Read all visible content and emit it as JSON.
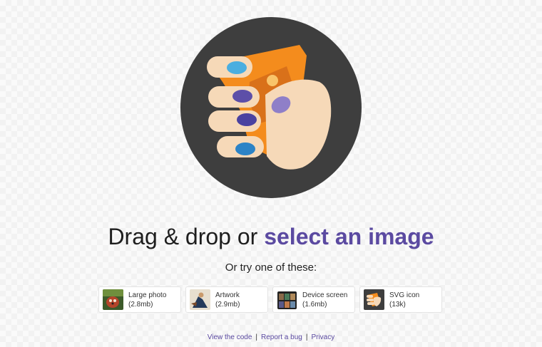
{
  "headline": {
    "prefix": "Drag & drop or",
    "link": "select an image"
  },
  "subline": "Or try one of these:",
  "demos": [
    {
      "title": "Large photo",
      "size": "(2.8mb)",
      "thumb_icon": "red-panda-photo-icon"
    },
    {
      "title": "Artwork",
      "size": "(2.9mb)",
      "thumb_icon": "artwork-icon"
    },
    {
      "title": "Device screen",
      "size": "(1.6mb)",
      "thumb_icon": "device-screen-icon"
    },
    {
      "title": "SVG icon",
      "size": "(13k)",
      "thumb_icon": "squoosh-logo-icon"
    }
  ],
  "footer": {
    "links": [
      "View the code",
      "Report a bug",
      "Privacy"
    ],
    "separator": "|"
  },
  "colors": {
    "accent": "#5b4aa1",
    "logo_circle": "#3e3e3e",
    "logo_orange": "#f48c1d",
    "nail_blue": "#2c83c6",
    "nail_purple": "#5d4fa8"
  },
  "icons": {
    "logo": "squoosh-hand-logo"
  }
}
